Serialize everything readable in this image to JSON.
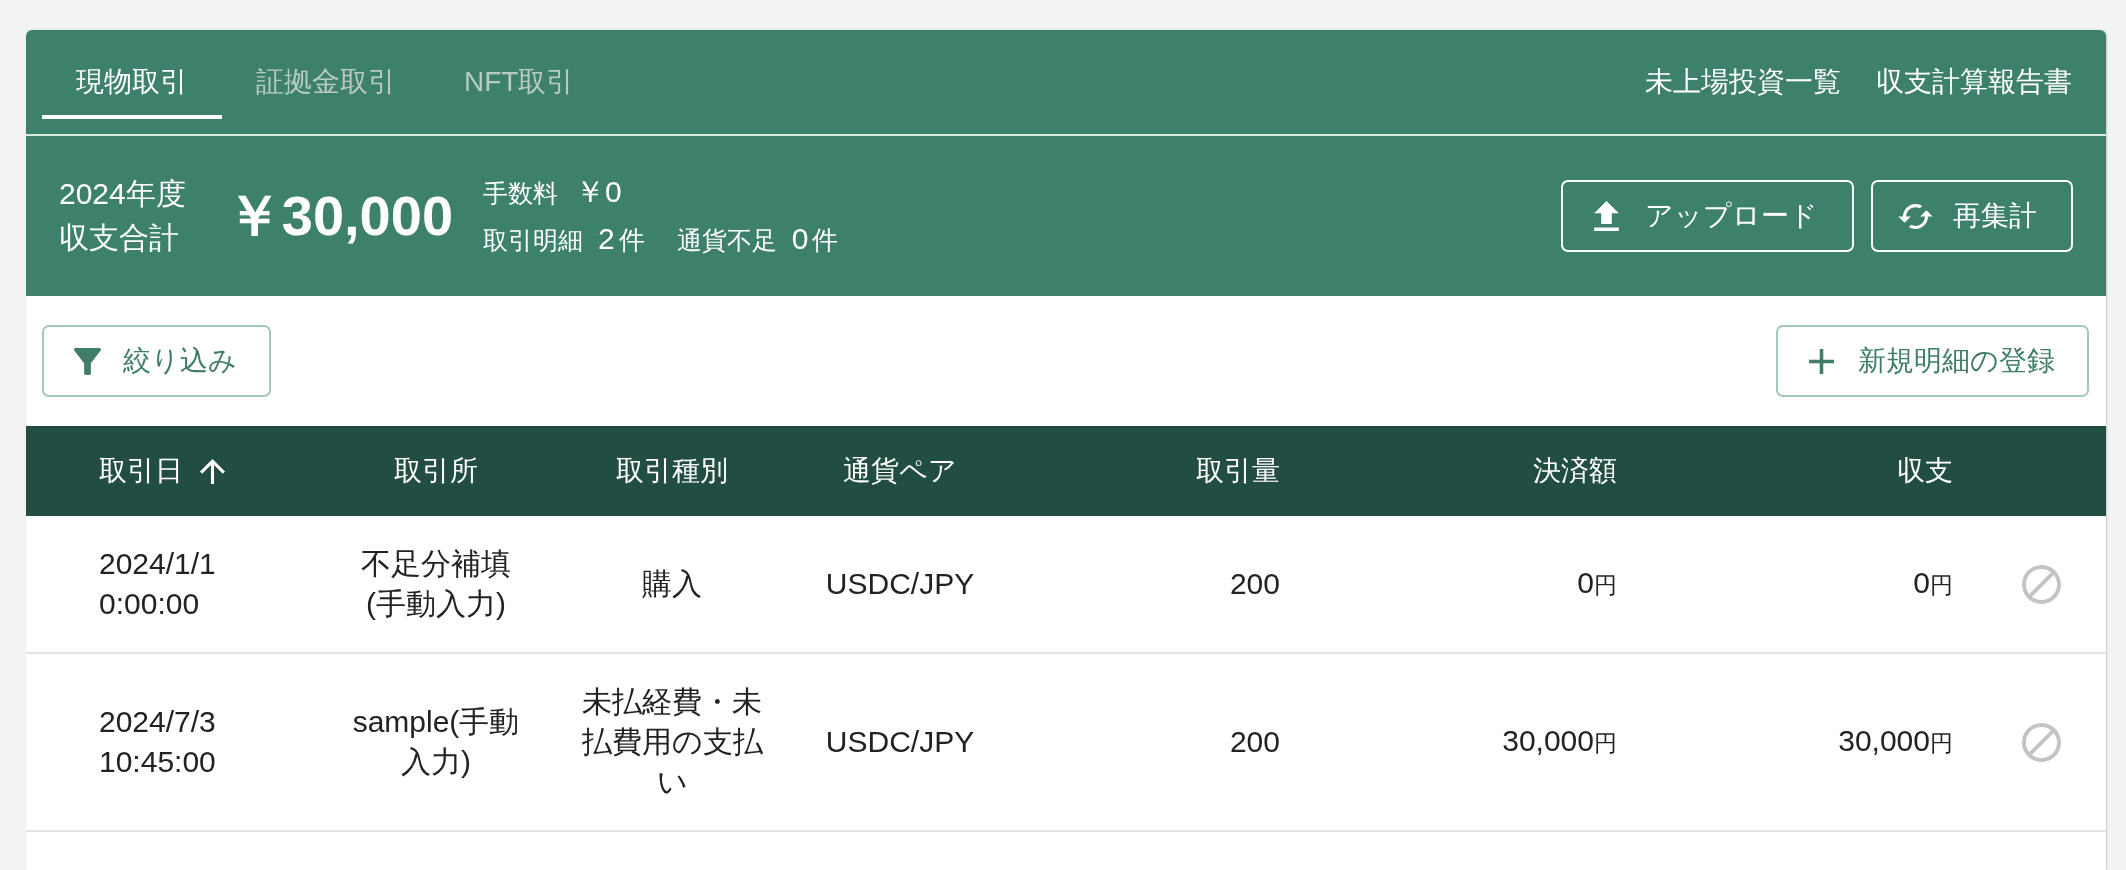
{
  "tabs": [
    {
      "label": "現物取引",
      "selected": true
    },
    {
      "label": "証拠金取引",
      "selected": false
    },
    {
      "label": "NFT取引",
      "selected": false
    }
  ],
  "links": [
    {
      "label": "未上場投資一覧"
    },
    {
      "label": "収支計算報告書"
    }
  ],
  "summary": {
    "year": "2024年度",
    "title": "収支合計",
    "total": "￥30,000",
    "fee": {
      "label": "手数料",
      "value": "￥0"
    },
    "counts": [
      {
        "label": "取引明細",
        "count": "2",
        "unit": "件"
      },
      {
        "label": "通貨不足",
        "count": "0",
        "unit": "件"
      }
    ]
  },
  "summary_actions": [
    {
      "kind": "upload",
      "label": "アップロード"
    },
    {
      "kind": "recalculate",
      "label": "再集計"
    }
  ],
  "toolbar": [
    {
      "kind": "filter",
      "label": "絞り込み"
    },
    {
      "kind": "add",
      "label": "新規明細の登録"
    }
  ],
  "table": {
    "columns": [
      {
        "label": "取引日",
        "sorted": true,
        "ascending": true
      },
      {
        "label": "取引所",
        "sorted": false
      },
      {
        "label": "取引種別",
        "sorted": false
      },
      {
        "label": "通貨ペア",
        "sorted": false
      },
      {
        "label": "取引量",
        "sorted": false
      },
      {
        "label": "決済額",
        "sorted": false
      },
      {
        "label": "収支",
        "sorted": false
      }
    ],
    "rows": [
      {
        "date": "2024/1/1 0:00:00",
        "exchange": "不足分補填(手動入力)",
        "type": "購入",
        "pair": "USDC/JPY",
        "quantity": "200",
        "settlement": {
          "amount": "0",
          "unit": "円"
        },
        "balance": {
          "amount": "0",
          "unit": "円"
        }
      },
      {
        "date": "2024/7/3 10:45:00",
        "exchange": "sample(手動入力)",
        "type": "未払経費・未払費用の支払い",
        "pair": "USDC/JPY",
        "quantity": "200",
        "settlement": {
          "amount": "30,000",
          "unit": "円"
        },
        "balance": {
          "amount": "30,000",
          "unit": "円"
        }
      }
    ]
  }
}
